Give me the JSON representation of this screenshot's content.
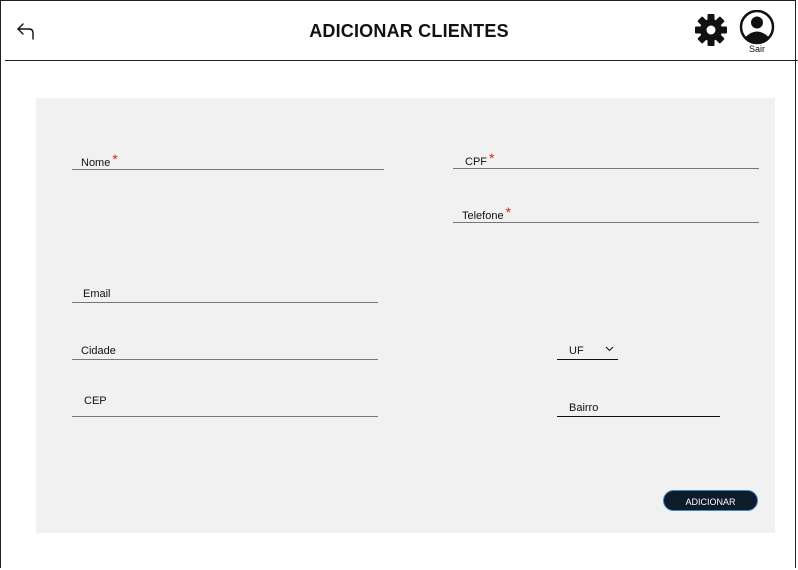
{
  "header": {
    "title": "ADICIONAR CLIENTES",
    "logout_label": "Sair"
  },
  "form": {
    "nome": {
      "label": "Nome",
      "required_mark": "*"
    },
    "cpf": {
      "label": "CPF",
      "required_mark": "*"
    },
    "telefone": {
      "label": "Telefone",
      "required_mark": "*"
    },
    "email": {
      "label": "Email"
    },
    "cidade": {
      "label": "Cidade"
    },
    "uf": {
      "label": "UF"
    },
    "cep": {
      "label": "CEP"
    },
    "bairro": {
      "label": "Bairro"
    },
    "submit_label": "ADICIONAR"
  },
  "icons": {
    "back": "back-arrow-icon",
    "settings": "gear-icon",
    "user": "user-avatar-icon",
    "dropdown": "chevron-down-icon"
  },
  "colors": {
    "panel_bg": "#f1f1f1",
    "required": "#e01e1e",
    "button_bg": "#0d1b2a",
    "button_border": "#3a8ac4"
  }
}
